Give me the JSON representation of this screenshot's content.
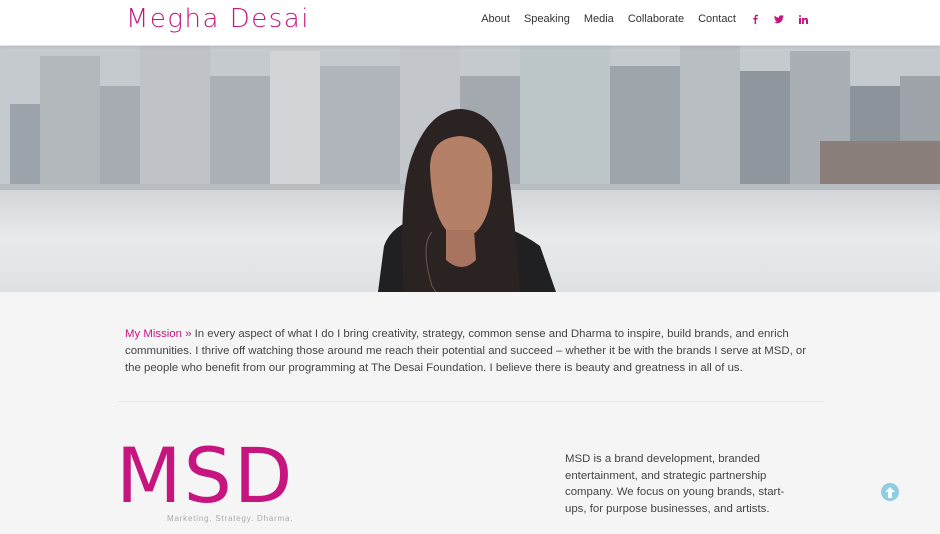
{
  "header": {
    "site_title": "Megha Desai",
    "nav": [
      "About",
      "Speaking",
      "Media",
      "Collaborate",
      "Contact"
    ],
    "social": [
      "facebook-icon",
      "twitter-icon",
      "linkedin-icon"
    ],
    "accent_color": "#c7157f"
  },
  "hero": {
    "image_description_icon": "hero-photo"
  },
  "mission": {
    "label": "My Mission »",
    "text": " In every aspect of what I do I bring creativity, strategy, common sense and Dharma to inspire, build brands, and enrich communities. I thrive off watching those around me reach their potential and succeed – whether it be with the brands I serve at MSD, or the people who benefit from our programming at The Desai Foundation. I believe there is beauty and greatness in all of us."
  },
  "msd": {
    "logo_text": "MSD",
    "tagline": "Marketing. Strategy. Dharma.",
    "description": "MSD is a brand development, branded entertainment, and strategic partnership company. We focus on young brands, start-ups, for purpose businesses, and artists."
  },
  "back_to_top": {
    "icon": "arrow-up-icon",
    "color": "#8fcde0"
  }
}
